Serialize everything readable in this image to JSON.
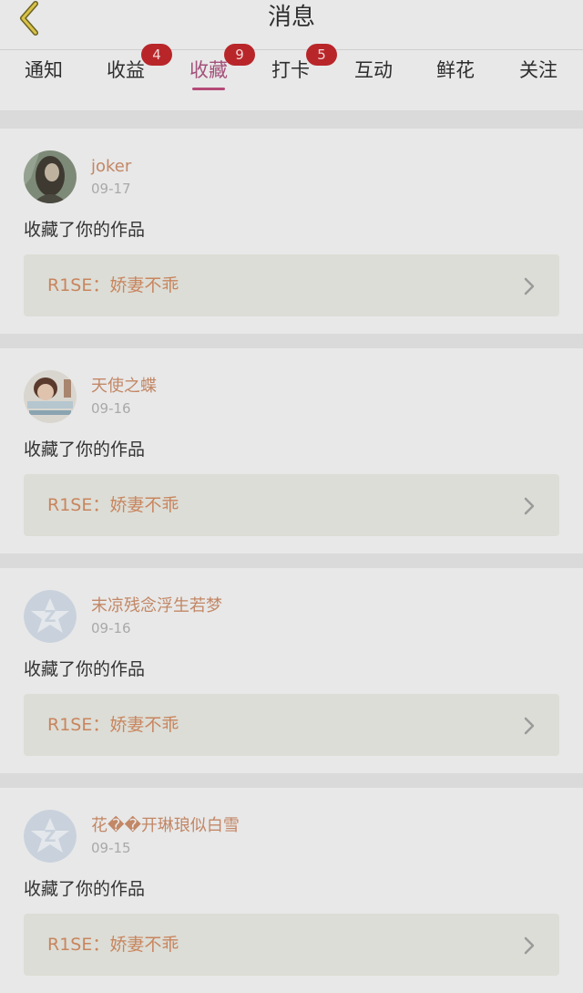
{
  "header": {
    "title": "消息",
    "back_icon": "chevron-left-icon"
  },
  "tabs": [
    {
      "label": "通知",
      "badge": ""
    },
    {
      "label": "收益",
      "badge": "4"
    },
    {
      "label": "收藏",
      "badge": "9",
      "active": true
    },
    {
      "label": "打卡",
      "badge": "5"
    },
    {
      "label": "互动",
      "badge": ""
    },
    {
      "label": "鲜花",
      "badge": ""
    },
    {
      "label": "关注",
      "badge": ""
    }
  ],
  "notifications": [
    {
      "user": "joker",
      "date": "09-17",
      "action": "收藏了你的作品",
      "work": "R1SE：娇妻不乖",
      "avatar": "photo-avatar"
    },
    {
      "user": "天使之蝶",
      "date": "09-16",
      "action": "收藏了你的作品",
      "work": "R1SE：娇妻不乖",
      "avatar": "photo-avatar"
    },
    {
      "user": "末凉残念浮生若梦",
      "date": "09-16",
      "action": "收藏了你的作品",
      "work": "R1SE：娇妻不乖",
      "avatar": "default-avatar-icon"
    },
    {
      "user": "花��开琳琅似白雪",
      "date": "09-15",
      "action": "收藏了你的作品",
      "work": "R1SE：娇妻不乖",
      "avatar": "default-avatar-icon"
    }
  ],
  "colors": {
    "active_tab": "#a3517a",
    "badge": "#b8262a",
    "username": "#c28766",
    "work_title": "#c8855e"
  }
}
